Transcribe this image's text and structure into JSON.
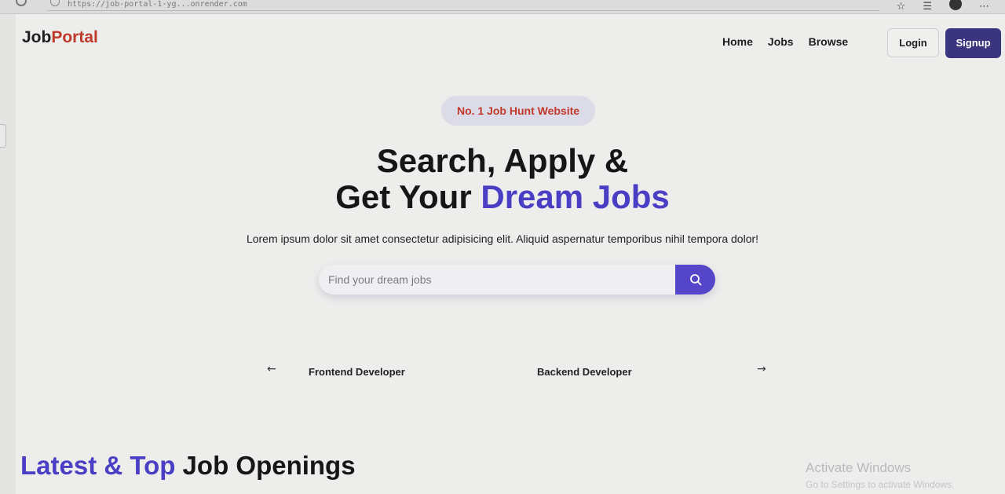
{
  "browser": {
    "url": "https://job-portal-1-yg...onrender.com",
    "icons": [
      "star-icon",
      "favorites-icon",
      "profile-icon",
      "more-icon"
    ]
  },
  "nav": {
    "logo_part1": "Job",
    "logo_part2": "Portal",
    "links": [
      "Home",
      "Jobs",
      "Browse"
    ],
    "login_label": "Login",
    "signup_label": "Signup"
  },
  "hero": {
    "badge": "No. 1 Job Hunt Website",
    "headline_line1": "Search, Apply &",
    "headline_line2_prefix": "Get Your ",
    "headline_line2_accent": "Dream Jobs",
    "subtext": "Lorem ipsum dolor sit amet consectetur adipisicing elit. Aliquid aspernatur temporibus nihil tempora dolor!",
    "search_placeholder": "Find your dream jobs"
  },
  "carousel": {
    "items": [
      "Frontend Developer",
      "Backend Developer"
    ],
    "prev_icon": "arrow-left-icon",
    "next_icon": "arrow-right-icon"
  },
  "section": {
    "latest_accent": "Latest & Top",
    "latest_rest": " Job Openings"
  },
  "watermark": {
    "line1": "Activate Windows",
    "line2": "Go to Settings to activate Windows."
  },
  "colors": {
    "brand_red": "#c0392b",
    "accent_purple": "#4a3fc4",
    "signup_bg": "#3b3580",
    "search_button": "#5546c9"
  }
}
